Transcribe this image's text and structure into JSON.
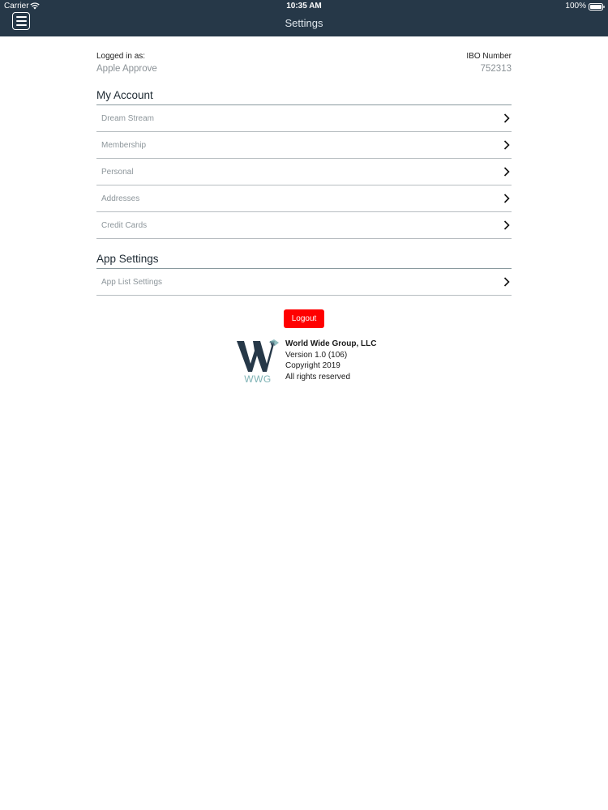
{
  "status_bar": {
    "carrier": "Carrier",
    "time": "10:35 AM",
    "battery": "100%"
  },
  "nav": {
    "title": "Settings",
    "menu_icon": "hamburger-menu-icon"
  },
  "account": {
    "logged_in_label": "Logged in as:",
    "logged_in_value": "Apple Approve",
    "ibo_label": "IBO Number",
    "ibo_value": "752313"
  },
  "my_account": {
    "title": "My Account",
    "items": [
      {
        "label": "Dream Stream"
      },
      {
        "label": "Membership"
      },
      {
        "label": "Personal"
      },
      {
        "label": "Addresses"
      },
      {
        "label": "Credit Cards"
      }
    ]
  },
  "app_settings": {
    "title": "App Settings",
    "items": [
      {
        "label": "App List Settings"
      }
    ]
  },
  "logout_label": "Logout",
  "footer": {
    "logo_text": "WWG",
    "company": "World Wide Group, LLC",
    "version": "Version 1.0 (106)",
    "copyright": "Copyright 2019",
    "rights": "All rights reserved"
  },
  "colors": {
    "nav_bg": "#263848",
    "logout_bg": "#ff0000",
    "logo_dark": "#263848",
    "logo_accent": "#7fb3b5"
  }
}
